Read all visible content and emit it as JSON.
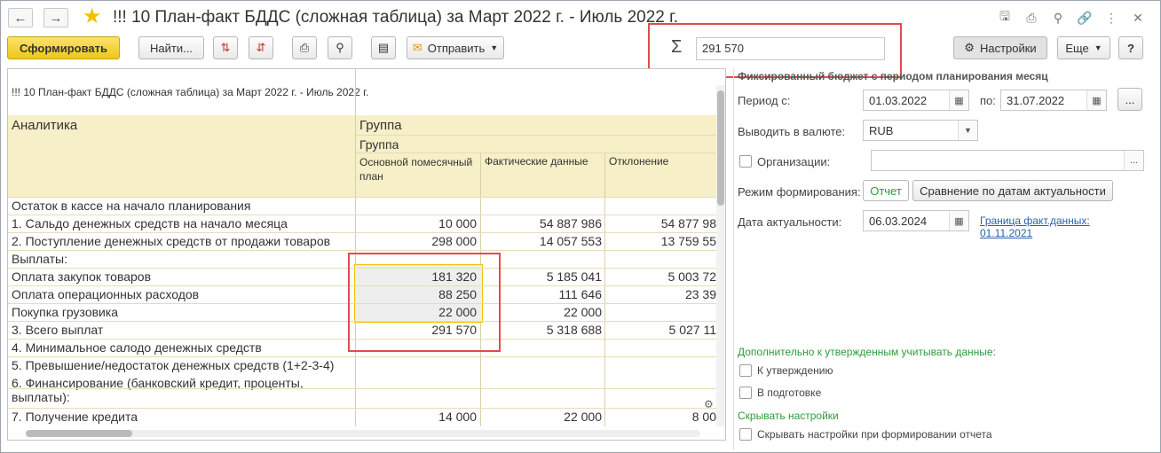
{
  "window": {
    "title": "!!! 10 План-факт БДДС (сложная таблица)  за Март 2022 г. - Июль 2022 г."
  },
  "toolbar": {
    "generate": "Сформировать",
    "find": "Найти...",
    "send": "Отправить",
    "settings": "Настройки",
    "more": "Еще",
    "help": "?"
  },
  "sum": {
    "sigma": "Σ",
    "value": "291 570"
  },
  "report": {
    "title": "!!! 10 План-факт БДДС (сложная таблица) за Март 2022 г. - Июль 2022 г.",
    "header": {
      "analytics": "Аналитика",
      "group1": "Группа",
      "group2": "Группа",
      "col_plan": "Основной помесячный план",
      "col_fact": "Фактические данные",
      "col_dev": "Отклонение"
    },
    "rows": [
      {
        "label": "Остаток в кассе на начало планирования",
        "plan": "",
        "fact": "",
        "dev": ""
      },
      {
        "label": "1. Сальдо денежных средств на начало месяца",
        "plan": "10 000",
        "fact": "54 887 986",
        "dev": "54 877 98"
      },
      {
        "label": "2. Поступление денежных средств от продажи товаров",
        "plan": "298 000",
        "fact": "14 057 553",
        "dev": "13 759 55"
      },
      {
        "label": "Выплаты:",
        "plan": "",
        "fact": "",
        "dev": ""
      },
      {
        "label": "Оплата закупок товаров",
        "plan": "181 320",
        "fact": "5 185 041",
        "dev": "5 003 72"
      },
      {
        "label": "Оплата операционных расходов",
        "plan": "88 250",
        "fact": "111 646",
        "dev": "23 39"
      },
      {
        "label": "Покупка грузовика",
        "plan": "22 000",
        "fact": "22 000",
        "dev": ""
      },
      {
        "label": "3. Всего выплат",
        "plan": "291 570",
        "fact": "5 318 688",
        "dev": "5 027 11"
      },
      {
        "label": "4. Минимальное салодо денежных средств",
        "plan": "",
        "fact": "",
        "dev": ""
      },
      {
        "label": "5. Превышение/недостаток денежных средств (1+2-3-4)",
        "plan": "",
        "fact": "",
        "dev": ""
      },
      {
        "label": "6. Финансирование (банковский кредит, проценты,",
        "plan": "",
        "fact": "",
        "dev": ""
      },
      {
        "label": "выплаты):",
        "plan": "",
        "fact": "",
        "dev": ""
      },
      {
        "label": "7. Получение кредита",
        "plan": "14 000",
        "fact": "22 000",
        "dev": "8 00"
      }
    ]
  },
  "settings_panel": {
    "section_title": "Фиксированный бюджет с периодом планирования месяц",
    "period_from_label": "Период с:",
    "period_from": "01.03.2022",
    "period_to_label": "по:",
    "period_to": "31.07.2022",
    "period_more": "...",
    "currency_label": "Выводить в валюте:",
    "currency": "RUB",
    "organizations_label": "Организации:",
    "organizations_more": "...",
    "mode_label": "Режим формирования:",
    "mode_report": "Отчет",
    "mode_compare": "Сравнение по датам актуальности",
    "actuality_label": "Дата актуальности:",
    "actuality_date": "06.03.2024",
    "fact_border_line1": "Граница факт.данных:",
    "fact_border_line2": "01.11.2021",
    "additional_title": "Дополнительно к утвержденным учитывать данные:",
    "for_approval": "К утверждению",
    "in_preparation": "В подготовке",
    "hide_settings_link": "Скрывать настройки",
    "hide_settings_check": "Скрывать настройки при формировании отчета"
  }
}
